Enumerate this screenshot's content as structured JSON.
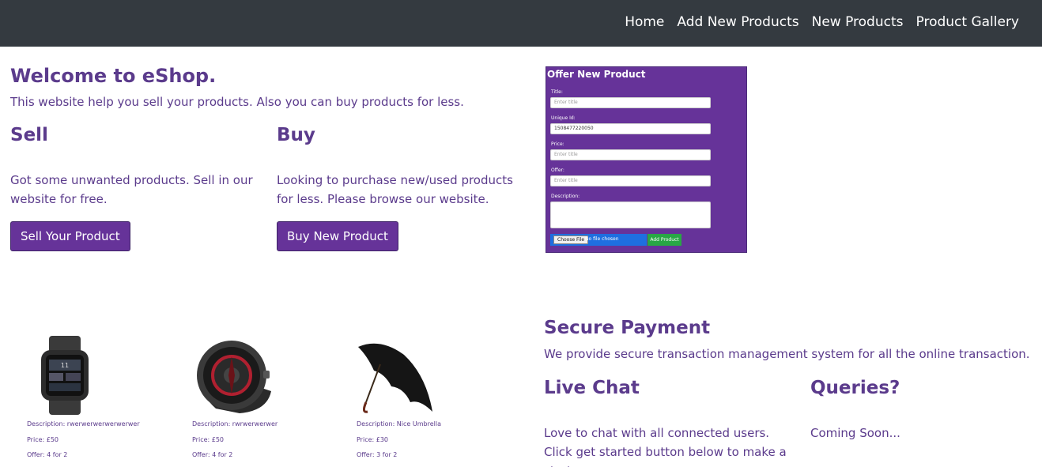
{
  "nav": {
    "items": [
      "Home",
      "Add New Products",
      "New Products",
      "Product Gallery"
    ]
  },
  "welcome": {
    "title": "Welcome to eShop.",
    "subtitle": "This website help you sell your products. Also you can buy products for less."
  },
  "sell": {
    "title": "Sell",
    "text": "Got some unwanted products. Sell in our website for free.",
    "button": "Sell Your Product"
  },
  "buy": {
    "title": "Buy",
    "text": "Looking to purchase new/used products for less. Please browse our website.",
    "button": "Buy New Product"
  },
  "offer_form": {
    "title": "Offer New Product",
    "title_label": "Title:",
    "title_placeholder": "Enter title",
    "id_label": "Unique Id:",
    "id_value": "1508477220050",
    "price_label": "Price:",
    "price_placeholder": "Enter title",
    "offer_label": "Offer:",
    "offer_placeholder": "Enter title",
    "description_label": "Description:",
    "file_button": "Choose File",
    "file_status": "No file chosen",
    "submit": "Add Product"
  },
  "products": [
    {
      "image": "smartwatch-icon",
      "description": "Description: rwerwerwerwerwerwer",
      "price": "Price: £50",
      "offer": "Offer: 4 for 2"
    },
    {
      "image": "watch-icon",
      "description": "Description: rwrwerwerwer",
      "price": "Price: £50",
      "offer": "Offer: 4 for 2"
    },
    {
      "image": "umbrella-icon",
      "description": "Description: Nice Umbrella",
      "price": "Price: £30",
      "offer": "Offer: 3 for 2"
    }
  ],
  "secure_payment": {
    "title": "Secure Payment",
    "text": "We provide secure transaction management system for all the online transaction."
  },
  "live_chat": {
    "title": "Live Chat",
    "text": "Love to chat with all connected users. Click get started button below to make a start."
  },
  "queries": {
    "title": "Queries?",
    "text": "Coming Soon..."
  },
  "colors": {
    "navbar": "#343a40",
    "accent": "#663399",
    "text": "#5b3b8c",
    "add_button": "#28a745"
  }
}
